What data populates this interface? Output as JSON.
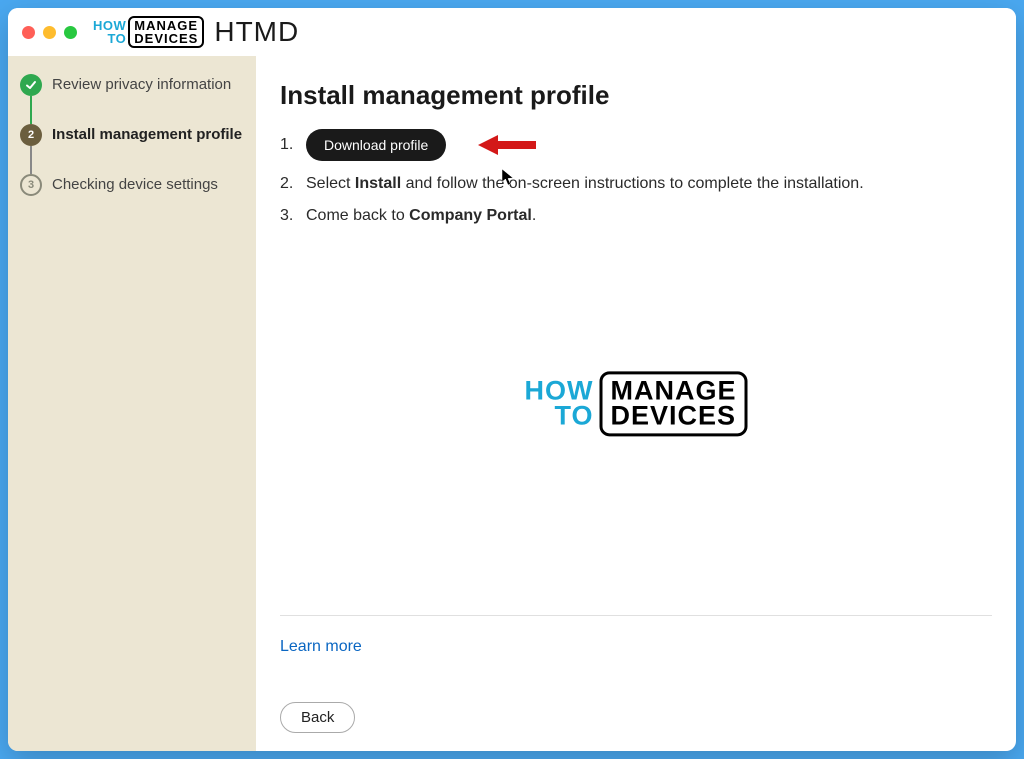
{
  "header": {
    "logo_how": "HOW",
    "logo_to": "TO",
    "logo_manage": "MANAGE",
    "logo_devices": "DEVICES",
    "title": "HTMD"
  },
  "sidebar": {
    "steps": [
      {
        "label": "Review privacy information",
        "state": "done"
      },
      {
        "label": "Install management profile",
        "state": "active",
        "num": "2"
      },
      {
        "label": "Checking device settings",
        "state": "pending",
        "num": "3"
      }
    ]
  },
  "main": {
    "title": "Install management profile",
    "instructions": {
      "n1": "1.",
      "download_label": "Download profile",
      "n2": "2.",
      "line2_pre": "Select ",
      "line2_bold": "Install",
      "line2_post": " and follow the on-screen instructions to complete the installation.",
      "n3": "3.",
      "line3_pre": "Come back to ",
      "line3_bold": "Company Portal",
      "line3_post": "."
    },
    "center_logo": {
      "how": "HOW",
      "to": "TO",
      "manage": "MANAGE",
      "devices": "DEVICES"
    },
    "learn_more": "Learn more",
    "back": "Back"
  }
}
